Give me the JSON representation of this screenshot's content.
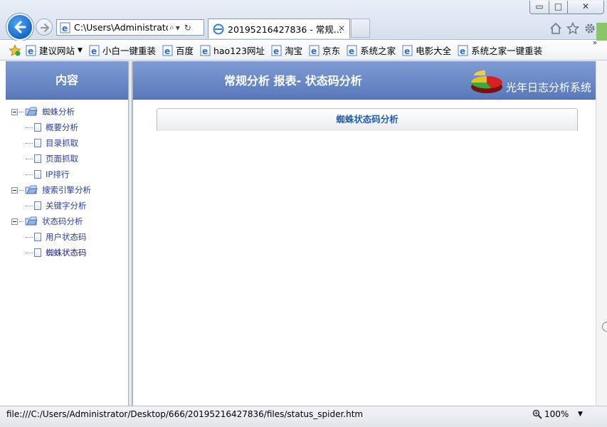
{
  "browser": {
    "window_buttons": {
      "minimize": "▭",
      "maximize": "□",
      "close": "✕"
    },
    "address": "C:\\Users\\Administrato",
    "address_tools": {
      "search": "⌕",
      "dropdown": "▾",
      "refresh": "↻"
    },
    "tab_title": "20195216427836 - 常规...",
    "tab_close": "✕",
    "favorites_bar": [
      {
        "label": "建议网站",
        "has_arrow": true
      },
      {
        "label": "小白一键重装"
      },
      {
        "label": "百度"
      },
      {
        "label": "hao123网址"
      },
      {
        "label": "淘宝"
      },
      {
        "label": "京东"
      },
      {
        "label": "系统之家"
      },
      {
        "label": "电影大全"
      },
      {
        "label": "系统之家一键重装"
      }
    ],
    "favorites_more": "»",
    "status_url": "file:///C:/Users/Administrator/Desktop/666/20195216427836/files/status_spider.htm",
    "zoom": "100%",
    "zoom_arrow": "▼"
  },
  "left_panel": {
    "title": "内容",
    "tree": [
      {
        "label": "蜘蛛分析",
        "children": [
          "概要分析",
          "目录抓取",
          "页面抓取",
          "IP排行"
        ]
      },
      {
        "label": "搜索引擎分析",
        "children": [
          "关键字分析"
        ]
      },
      {
        "label": "状态码分析",
        "children": [
          "用户状态码",
          "蜘蛛状态码"
        ]
      }
    ]
  },
  "main": {
    "title": "常规分析 报表- 状态码分析",
    "logo_text": "光年日志分析系统",
    "section_title": "蜘蛛状态码分析"
  },
  "colors": {
    "header_blue": "#5879bc",
    "link_blue": "#2a3e9a",
    "section_title": "#1f5fb8",
    "fav_strip_green": "#8cc46a"
  }
}
